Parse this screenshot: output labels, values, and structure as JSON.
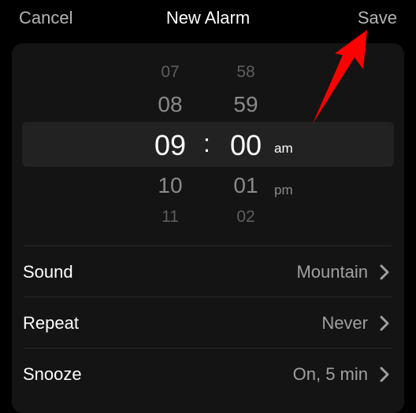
{
  "nav": {
    "cancel_label": "Cancel",
    "title": "New Alarm",
    "save_label": "Save"
  },
  "picker": {
    "hours": [
      "07",
      "08",
      "09",
      "10",
      "11"
    ],
    "minutes": [
      "58",
      "59",
      "00",
      "01",
      "02"
    ],
    "separator": ":",
    "period_options": [
      "am",
      "pm"
    ],
    "selected": {
      "hour": "09",
      "minute": "00",
      "period": "am"
    }
  },
  "settings": [
    {
      "label": "Sound",
      "value": "Mountain",
      "icon": "chevron-right-icon"
    },
    {
      "label": "Repeat",
      "value": "Never",
      "icon": "chevron-right-icon"
    },
    {
      "label": "Snooze",
      "value": "On, 5 min",
      "icon": "chevron-right-icon"
    }
  ],
  "annotation": {
    "type": "arrow",
    "points_to": "Save",
    "color": "#ff0000"
  },
  "colors": {
    "background": "#000000",
    "panel": "#141414",
    "selection_band": "#222222",
    "nav_button": "#b4b4b4",
    "secondary_text": "#a0a0a0"
  }
}
